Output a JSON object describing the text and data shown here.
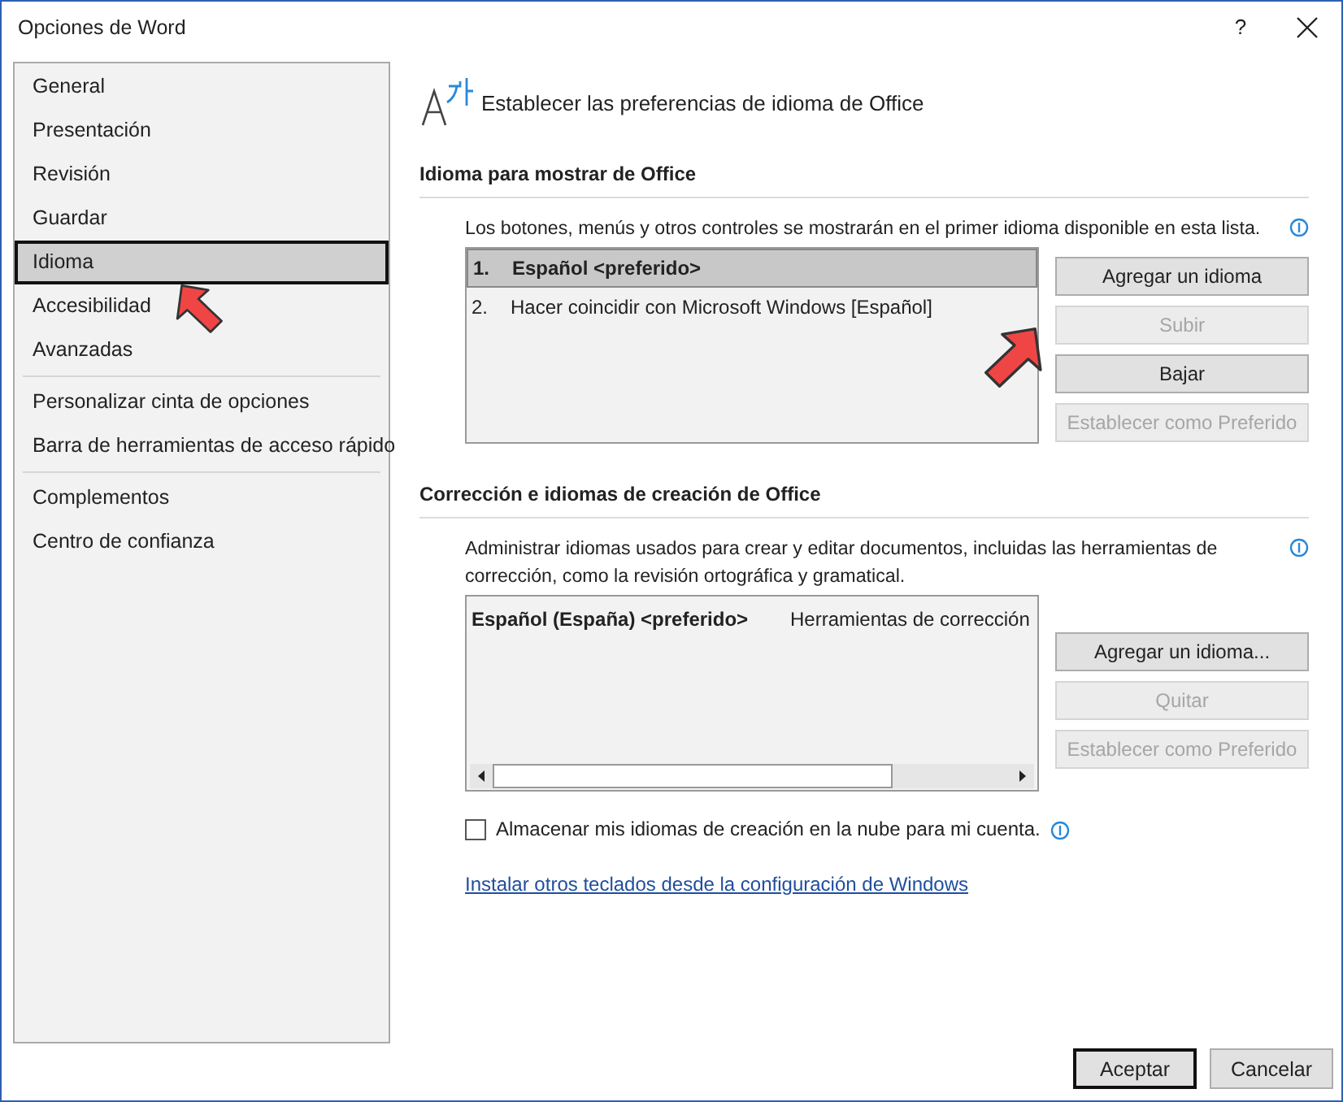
{
  "window": {
    "title": "Opciones de Word",
    "help": "?"
  },
  "sidebar": {
    "groups": [
      [
        {
          "label": "General",
          "selected": false
        },
        {
          "label": "Presentación",
          "selected": false
        },
        {
          "label": "Revisión",
          "selected": false
        },
        {
          "label": "Guardar",
          "selected": false
        },
        {
          "label": "Idioma",
          "selected": true
        },
        {
          "label": "Accesibilidad",
          "selected": false
        },
        {
          "label": "Avanzadas",
          "selected": false
        }
      ],
      [
        {
          "label": "Personalizar cinta de opciones",
          "selected": false
        },
        {
          "label": "Barra de herramientas de acceso rápido",
          "selected": false
        }
      ],
      [
        {
          "label": "Complementos",
          "selected": false
        },
        {
          "label": "Centro de confianza",
          "selected": false
        }
      ]
    ]
  },
  "header": {
    "title": "Establecer las preferencias de idioma de Office"
  },
  "display_section": {
    "heading": "Idioma para mostrar de Office",
    "description": "Los botones, menús y otros controles se mostrarán en el primer idioma disponible en esta lista.",
    "languages": [
      {
        "number": "1.",
        "name": "Español <preferido>",
        "selected": true
      },
      {
        "number": "2.",
        "name": "Hacer coincidir con Microsoft Windows [Español]",
        "selected": false
      }
    ],
    "buttons": [
      {
        "label": "Agregar un idioma",
        "disabled": false
      },
      {
        "label": "Subir",
        "disabled": true
      },
      {
        "label": "Bajar",
        "disabled": false
      },
      {
        "label": "Establecer como Preferido",
        "disabled": true
      }
    ]
  },
  "authoring_section": {
    "heading": "Corrección e idiomas de creación de Office",
    "description": "Administrar idiomas usados para crear y editar documentos, incluidas las herramientas de corrección, como la revisión ortográfica y gramatical.",
    "languages": [
      {
        "name": "Español (España) <preferido>",
        "column_2": "Herramientas de corrección"
      }
    ],
    "buttons": [
      {
        "label": "Agregar un idioma...",
        "disabled": false
      },
      {
        "label": "Quitar",
        "disabled": true
      },
      {
        "label": "Establecer como Preferido",
        "disabled": true
      }
    ],
    "cloud_checkbox": {
      "label": "Almacenar mis idiomas de creación en la nube para mi cuenta.",
      "checked": false
    },
    "link": "Instalar otros teclados desde la configuración de Windows"
  },
  "footer": {
    "buttons": [
      {
        "label": "Aceptar",
        "default": true
      },
      {
        "label": "Cancelar",
        "default": false
      }
    ]
  }
}
